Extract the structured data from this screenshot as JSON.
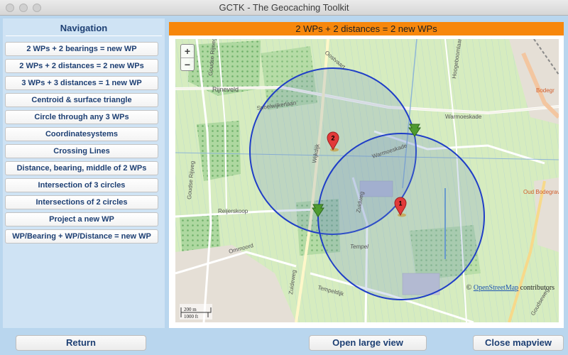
{
  "window": {
    "title": "GCTK - The Geocaching Toolkit"
  },
  "navigation": {
    "title": "Navigation",
    "items": [
      "2 WPs + 2 bearings = new WP",
      "2 WPs + 2 distances = 2 new WPs",
      "3 WPs + 3 distances = 1 new WP",
      "Centroid & surface triangle",
      "Circle through any 3 WPs",
      "Coordinatesystems",
      "Crossing Lines",
      "Distance, bearing, middle of 2 WPs",
      "Intersection of 3 circles",
      "Intersections of 2 circles",
      "Project a new WP",
      "WP/Bearing + WP/Distance = new WP"
    ]
  },
  "map": {
    "header": "2 WPs + 2 distances = 2 new WPs",
    "zoom_in": "+",
    "zoom_out": "−",
    "attribution_symbol": "©",
    "attribution_link": "OpenStreetMap",
    "attribution_suffix": " contributors",
    "scale_metric": "200 m",
    "scale_imperial": "1000 ft",
    "markers": {
      "wp1": "1",
      "wp2": "2"
    },
    "labels": {
      "rijneveld": "Rijneveld",
      "spoelwijkerlaan": "Spoelwijkerlaan",
      "warmoeskade_e": "Warmoeskade",
      "warmoeskade_c": "Warmoeskade",
      "reijerskoop": "Reijerskoop",
      "zuidweg": "Zuidweg",
      "tempel": "Tempel",
      "tempeldijk": "Tempeldijk",
      "ommoord": "Ommoord",
      "bodegr": "Bodegr",
      "oud_bodegraven": "Oud Bodegraven",
      "goudseweg": "Goudseweg",
      "goudse_rijweg_n": "Goudse Rijweg",
      "goudse_rijweg_s": "Goudse Rijweg",
      "wijkdijk": "Wijkdijk",
      "hoogeboomlaan": "Hoogeboomlaan",
      "oostvaart": "Oostvaart",
      "zuideweg": "Zuideweg"
    },
    "colors": {
      "circle": "#1f3ec7",
      "marker": "#e23a3a",
      "intersection_marker": "#4f9b2f",
      "header_bg": "#f7870c"
    }
  },
  "buttons": {
    "return": "Return",
    "open_large_view": "Open large view",
    "close_mapview": "Close mapview"
  }
}
